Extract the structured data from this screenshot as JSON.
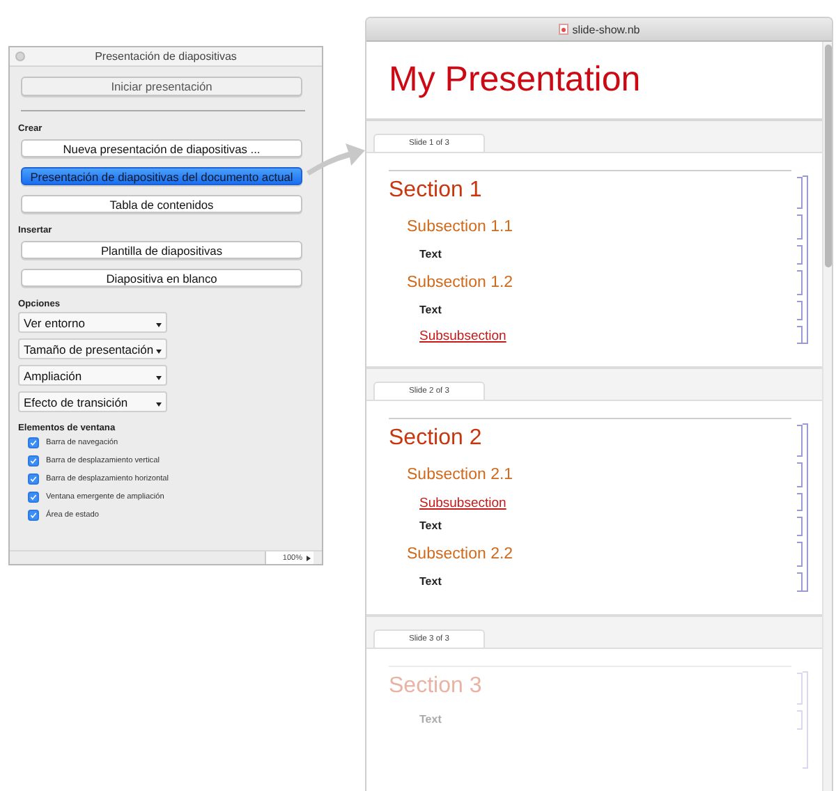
{
  "palette": {
    "title": "Presentación de diapositivas",
    "start_button": "Iniciar presentación",
    "sections": [
      {
        "heading": "Crear",
        "buttons": [
          {
            "label": "Nueva presentación de diapositivas ...",
            "selected": false
          },
          {
            "label": "Presentación de diapositivas del documento actual",
            "selected": true
          },
          {
            "label": "Tabla de contenidos",
            "selected": false
          }
        ]
      },
      {
        "heading": "Insertar",
        "buttons": [
          {
            "label": "Plantilla de diapositivas",
            "selected": false
          },
          {
            "label": "Diapositiva en blanco",
            "selected": false
          }
        ]
      }
    ],
    "options_heading": "Opciones",
    "dropdowns": [
      "Ver entorno",
      "Tamaño de presentación",
      "Ampliación",
      "Efecto de transición"
    ],
    "window_elements_heading": "Elementos de ventana",
    "checkboxes": [
      {
        "label": "Barra de navegación",
        "checked": true
      },
      {
        "label": "Barra de desplazamiento vertical",
        "checked": true
      },
      {
        "label": "Barra de desplazamiento horizontal",
        "checked": true
      },
      {
        "label": "Ventana emergente de ampliación",
        "checked": true
      },
      {
        "label": "Área de estado",
        "checked": true
      }
    ],
    "zoom": "100%"
  },
  "notebook": {
    "window": {
      "title": "slide-show.nb"
    },
    "title": "My Presentation",
    "slides": [
      {
        "tab": "Slide 1 of 3",
        "faded": false,
        "cells": [
          {
            "kind": "section",
            "text": "Section 1"
          },
          {
            "kind": "subsection",
            "text": "Subsection 1.1"
          },
          {
            "kind": "text",
            "text": "Text"
          },
          {
            "kind": "subsection",
            "text": "Subsection 1.2"
          },
          {
            "kind": "text",
            "text": "Text"
          },
          {
            "kind": "subsubsection",
            "text": "Subsubsection"
          }
        ]
      },
      {
        "tab": "Slide 2 of 3",
        "faded": false,
        "cells": [
          {
            "kind": "section",
            "text": "Section 2"
          },
          {
            "kind": "subsection",
            "text": "Subsection 2.1"
          },
          {
            "kind": "subsubsection",
            "text": "Subsubsection"
          },
          {
            "kind": "text",
            "text": "Text"
          },
          {
            "kind": "subsection",
            "text": "Subsection 2.2"
          },
          {
            "kind": "text",
            "text": "Text"
          }
        ]
      },
      {
        "tab": "Slide 3 of 3",
        "faded": true,
        "cells": [
          {
            "kind": "section",
            "text": "Section 3"
          },
          {
            "kind": "text",
            "text": "Text"
          }
        ]
      }
    ]
  }
}
